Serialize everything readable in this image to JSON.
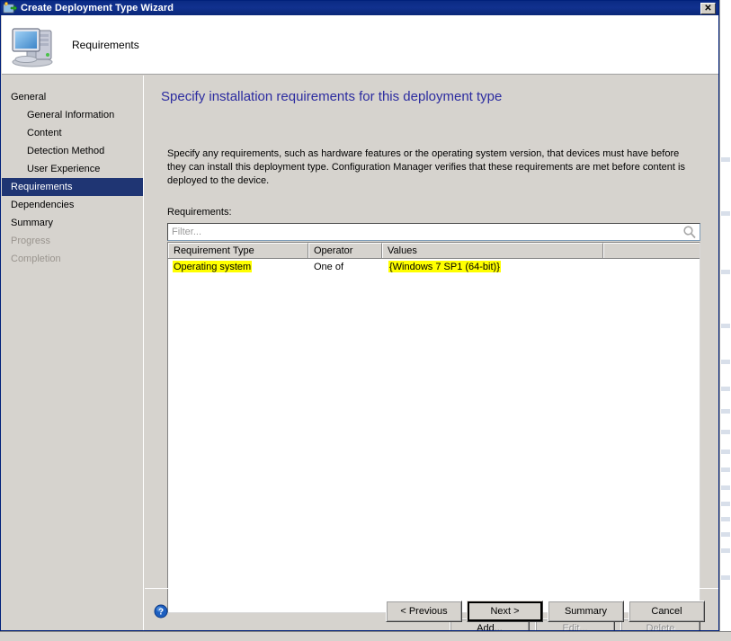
{
  "window": {
    "title": "Create Deployment Type Wizard",
    "close_label": "✕",
    "titlebar_icon": "deployment-type-icon"
  },
  "header": {
    "title": "Requirements",
    "icon": "computer-icon"
  },
  "sidebar": {
    "items": [
      {
        "label": "General",
        "level": 0,
        "state": "normal"
      },
      {
        "label": "General Information",
        "level": 1,
        "state": "normal"
      },
      {
        "label": "Content",
        "level": 1,
        "state": "normal"
      },
      {
        "label": "Detection Method",
        "level": 1,
        "state": "normal"
      },
      {
        "label": "User Experience",
        "level": 1,
        "state": "normal"
      },
      {
        "label": "Requirements",
        "level": 0,
        "state": "selected"
      },
      {
        "label": "Dependencies",
        "level": 0,
        "state": "normal"
      },
      {
        "label": "Summary",
        "level": 0,
        "state": "normal"
      },
      {
        "label": "Progress",
        "level": 0,
        "state": "disabled"
      },
      {
        "label": "Completion",
        "level": 0,
        "state": "disabled"
      }
    ]
  },
  "page": {
    "heading": "Specify installation requirements for this deployment type",
    "description": "Specify any requirements, such as hardware features or the operating system version, that devices must have before they can install this deployment type. Configuration Manager verifies that these requirements are met before content is deployed to the device.",
    "list_label": "Requirements:"
  },
  "filter": {
    "placeholder": "Filter...",
    "value": "",
    "icon": "search-icon"
  },
  "requirements_table": {
    "columns": [
      "Requirement Type",
      "Operator",
      "Values",
      ""
    ],
    "rows": [
      {
        "type": "Operating system",
        "type_highlighted": true,
        "operator": "One of",
        "operator_highlighted": false,
        "values": "{Windows 7 SP1 (64-bit)}",
        "values_highlighted": true
      }
    ]
  },
  "list_actions": {
    "add": "Add...",
    "edit": "Edit...",
    "delete": "Delete",
    "add_enabled": true,
    "edit_enabled": false,
    "delete_enabled": false
  },
  "footer": {
    "help_icon": "help-icon",
    "previous": "< Previous",
    "next": "Next >",
    "summary": "Summary",
    "cancel": "Cancel"
  },
  "colors": {
    "titlebar": "#0a2a83",
    "dialog_face": "#d6d3ce",
    "heading_text": "#2c2ca0",
    "selection": "#1f3573",
    "highlight": "#ffff00",
    "disabled_text": "#9a958f"
  }
}
